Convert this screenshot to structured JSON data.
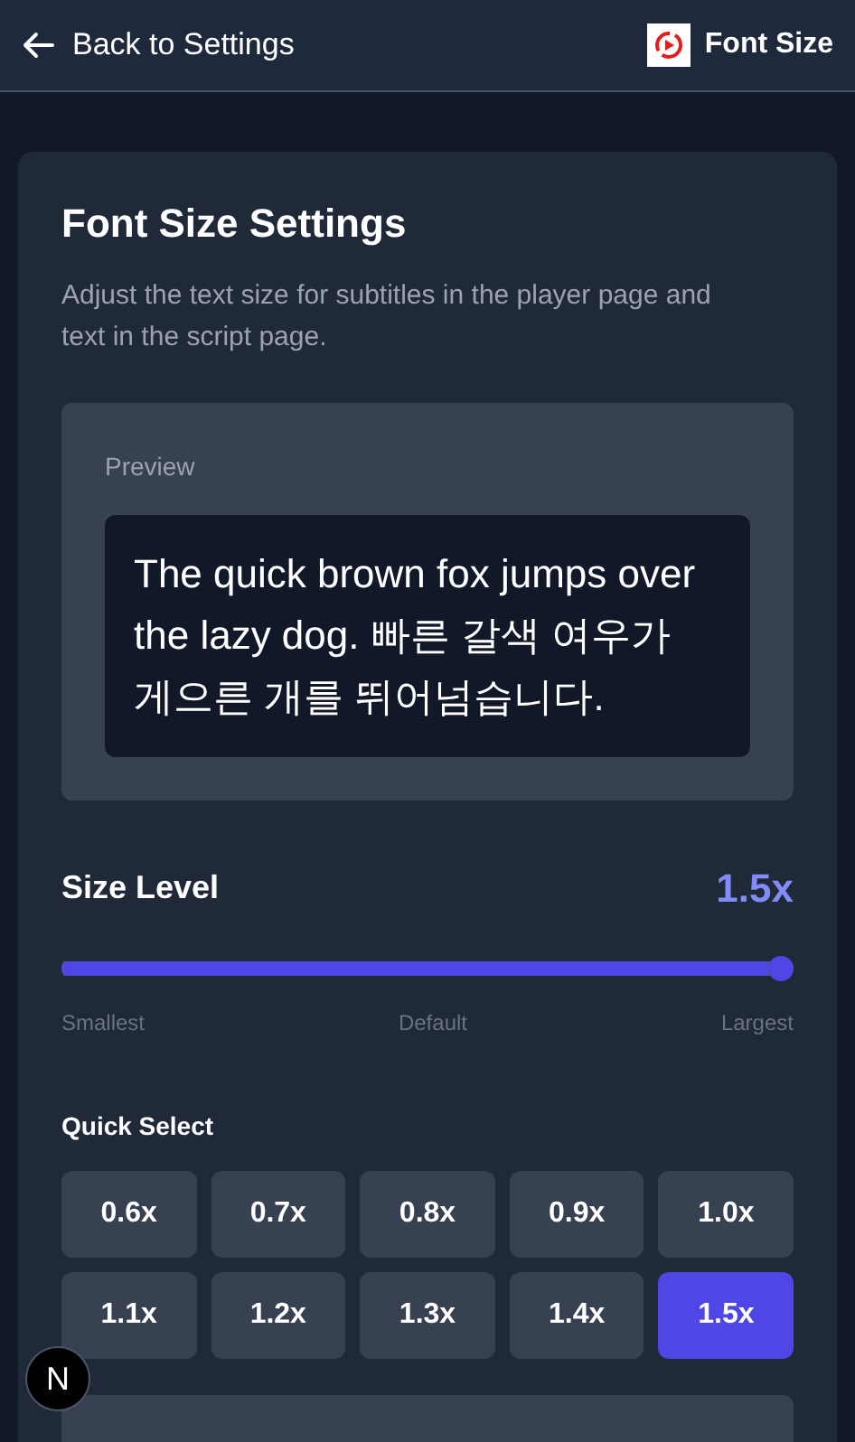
{
  "header": {
    "back_label": "Back to Settings",
    "title": "Font Size"
  },
  "card": {
    "title": "Font Size Settings",
    "description": "Adjust the text size for subtitles in the player page and text in the script page.",
    "preview": {
      "label": "Preview",
      "text": "The quick brown fox jumps over the lazy dog. 빠른 갈색 여우가 게으른 개를 뛰어넘습니다."
    },
    "size_level": {
      "label": "Size Level",
      "value": "1.5x",
      "level": 1,
      "ticks": [
        "Smallest",
        "Default",
        "Largest"
      ]
    },
    "quick_select": {
      "label": "Quick Select",
      "options": [
        {
          "label": "0.6x",
          "selected": false
        },
        {
          "label": "0.7x",
          "selected": false
        },
        {
          "label": "0.8x",
          "selected": false
        },
        {
          "label": "0.9x",
          "selected": false
        },
        {
          "label": "1.0x",
          "selected": false
        },
        {
          "label": "1.1x",
          "selected": false
        },
        {
          "label": "1.2x",
          "selected": false
        },
        {
          "label": "1.3x",
          "selected": false
        },
        {
          "label": "1.4x",
          "selected": false
        },
        {
          "label": "1.5x",
          "selected": true
        }
      ]
    }
  },
  "dev_badge": {
    "label": "N"
  }
}
